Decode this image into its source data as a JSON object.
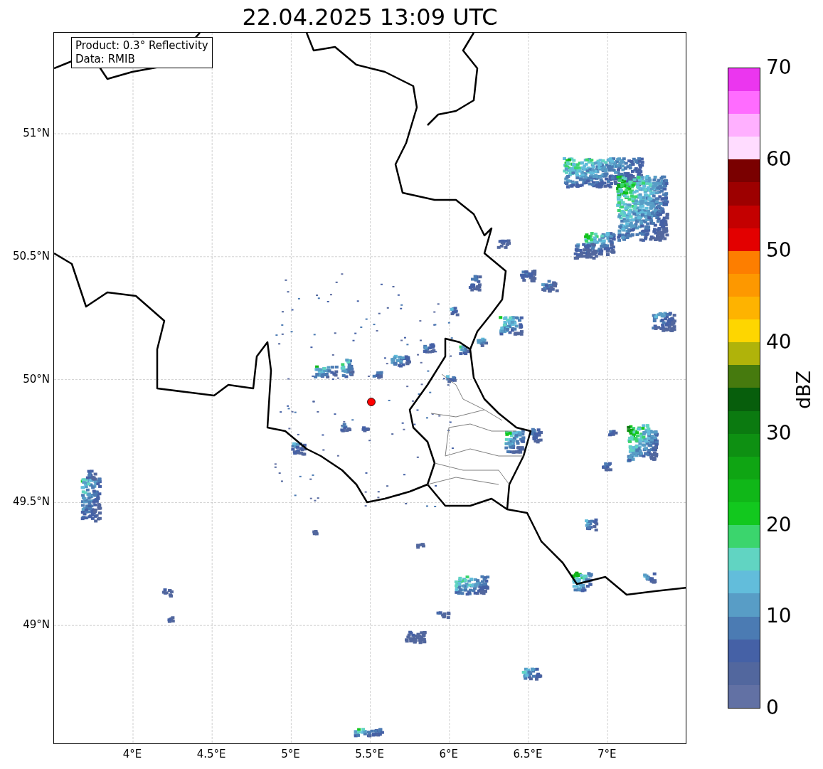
{
  "title": "22.04.2025 13:09 UTC",
  "info_box": [
    "Product: 0.3° Reflectivity",
    "Data: RMIB"
  ],
  "x_ticks": [
    "4°E",
    "4.5°E",
    "5°E",
    "5.5°E",
    "6°E",
    "6.5°E",
    "7°E"
  ],
  "y_ticks": [
    "51°N",
    "50.5°N",
    "50°N",
    "49.5°N",
    "49°N"
  ],
  "colorbar": {
    "label": "dBZ",
    "ticks": [
      "70",
      "60",
      "50",
      "40",
      "30",
      "20",
      "10",
      "0"
    ],
    "segments": [
      {
        "color": "#6271a4"
      },
      {
        "color": "#52679e"
      },
      {
        "color": "#4561a6"
      },
      {
        "color": "#4b7bb3"
      },
      {
        "color": "#589dc6"
      },
      {
        "color": "#62bddb"
      },
      {
        "color": "#61d4c2"
      },
      {
        "color": "#3bd56d"
      },
      {
        "color": "#12c81e"
      },
      {
        "color": "#10b718"
      },
      {
        "color": "#0fa513"
      },
      {
        "color": "#0e9012"
      },
      {
        "color": "#0b7a10"
      },
      {
        "color": "#075e0c"
      },
      {
        "color": "#467a0e"
      },
      {
        "color": "#b0b30a"
      },
      {
        "color": "#fed600"
      },
      {
        "color": "#feb300"
      },
      {
        "color": "#fd9800"
      },
      {
        "color": "#fd7e00"
      },
      {
        "color": "#e30000"
      },
      {
        "color": "#c40000"
      },
      {
        "color": "#9d0000"
      },
      {
        "color": "#7a0000"
      },
      {
        "color": "#ffdcff"
      },
      {
        "color": "#ffb0ff"
      },
      {
        "color": "#ff6cff"
      },
      {
        "color": "#eb36ef"
      }
    ]
  }
}
